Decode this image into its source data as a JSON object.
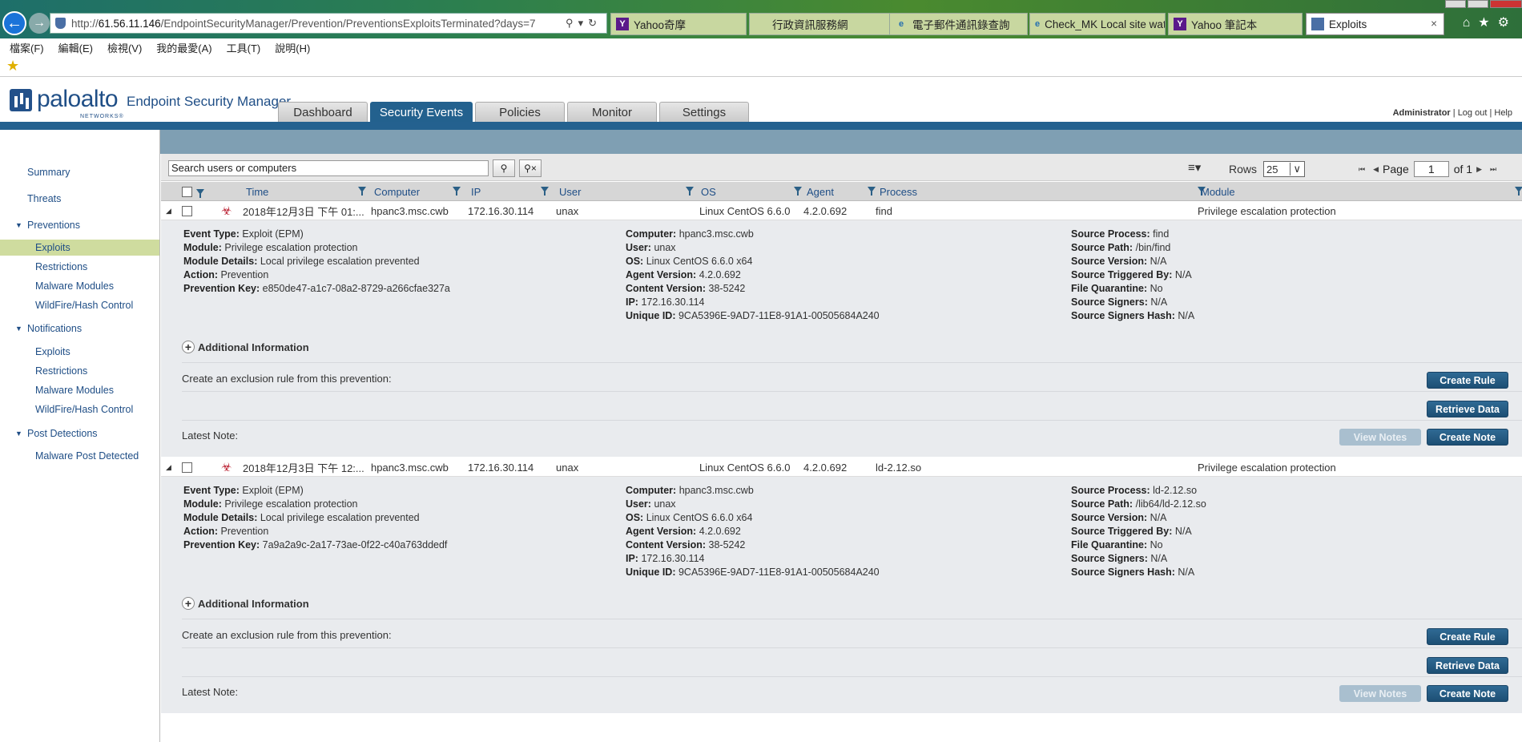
{
  "browser": {
    "url_prefix": "http://",
    "url_host": "61.56.11.146",
    "url_path": "/EndpointSecurityManager/Prevention/PreventionsExploitsTerminated?days=7",
    "tabs": [
      {
        "label": "Yahoo奇摩",
        "icon": "Y"
      },
      {
        "label": "行政資訊服務網",
        "icon": "行"
      },
      {
        "label": "電子郵件通訊錄查詢",
        "icon": "e"
      },
      {
        "label": "Check_MK Local site wat...",
        "icon": "e"
      },
      {
        "label": "Yahoo 筆記本",
        "icon": "Y"
      },
      {
        "label": "Exploits",
        "icon": "shield",
        "active": true
      }
    ],
    "menu": [
      "檔案(F)",
      "編輯(E)",
      "檢視(V)",
      "我的最愛(A)",
      "工具(T)",
      "說明(H)"
    ]
  },
  "app": {
    "logo_word": "paloalto",
    "logo_sub": "NETWORKS®",
    "product": "Endpoint Security Manager",
    "nav": [
      "Dashboard",
      "Security Events",
      "Policies",
      "Monitor",
      "Settings"
    ],
    "active_nav": "Security Events",
    "user": "Administrator",
    "logout": "Log out",
    "help": "Help"
  },
  "sidebar": {
    "summary": "Summary",
    "threats": "Threats",
    "preventions": "Preventions",
    "prev_items": [
      "Exploits",
      "Restrictions",
      "Malware Modules",
      "WildFire/Hash Control"
    ],
    "notifications": "Notifications",
    "notif_items": [
      "Exploits",
      "Restrictions",
      "Malware Modules",
      "WildFire/Hash Control"
    ],
    "post": "Post Detections",
    "post_items": [
      "Malware Post Detected"
    ]
  },
  "toolbar": {
    "search_placeholder": "Search users or computers",
    "rows_label": "Rows",
    "rows_value": "25",
    "page_label": "Page",
    "page_value": "1",
    "of_label": "of 1"
  },
  "columns": [
    "Time",
    "Computer",
    "IP",
    "User",
    "OS",
    "Agent",
    "Process",
    "Module"
  ],
  "events": [
    {
      "time": "2018年12月3日 下午 01:...",
      "computer": "hpanc3.msc.cwb",
      "ip": "172.16.30.114",
      "user": "unax",
      "os": "Linux CentOS 6.6.0",
      "agent": "4.2.0.692",
      "process": "find",
      "module": "Privilege escalation protection",
      "left": [
        [
          "Event Type:",
          "Exploit (EPM)"
        ],
        [
          "Module:",
          "Privilege escalation protection"
        ],
        [
          "Module Details:",
          "Local privilege escalation prevented"
        ],
        [
          "Action:",
          "Prevention"
        ],
        [
          "Prevention Key:",
          "e850de47-a1c7-08a2-8729-a266cfae327a"
        ]
      ],
      "mid": [
        [
          "Computer:",
          "hpanc3.msc.cwb"
        ],
        [
          "User:",
          "unax"
        ],
        [
          "OS:",
          "Linux CentOS 6.6.0 x64"
        ],
        [
          "Agent Version:",
          "4.2.0.692"
        ],
        [
          "Content Version:",
          "38-5242"
        ],
        [
          "IP:",
          "172.16.30.114"
        ],
        [
          "Unique ID:",
          "9CA5396E-9AD7-11E8-91A1-00505684A240"
        ]
      ],
      "right": [
        [
          "Source Process:",
          "find"
        ],
        [
          "Source Path:",
          "/bin/find"
        ],
        [
          "Source Version:",
          "N/A"
        ],
        [
          "Source Triggered By:",
          "N/A"
        ],
        [
          "File Quarantine:",
          "No"
        ],
        [
          "Source Signers:",
          "N/A"
        ],
        [
          "Source Signers Hash:",
          "N/A"
        ]
      ]
    },
    {
      "time": "2018年12月3日 下午 12:...",
      "computer": "hpanc3.msc.cwb",
      "ip": "172.16.30.114",
      "user": "unax",
      "os": "Linux CentOS 6.6.0",
      "agent": "4.2.0.692",
      "process": "ld-2.12.so",
      "module": "Privilege escalation protection",
      "left": [
        [
          "Event Type:",
          "Exploit (EPM)"
        ],
        [
          "Module:",
          "Privilege escalation protection"
        ],
        [
          "Module Details:",
          "Local privilege escalation prevented"
        ],
        [
          "Action:",
          "Prevention"
        ],
        [
          "Prevention Key:",
          "7a9a2a9c-2a17-73ae-0f22-c40a763ddedf"
        ]
      ],
      "mid": [
        [
          "Computer:",
          "hpanc3.msc.cwb"
        ],
        [
          "User:",
          "unax"
        ],
        [
          "OS:",
          "Linux CentOS 6.6.0 x64"
        ],
        [
          "Agent Version:",
          "4.2.0.692"
        ],
        [
          "Content Version:",
          "38-5242"
        ],
        [
          "IP:",
          "172.16.30.114"
        ],
        [
          "Unique ID:",
          "9CA5396E-9AD7-11E8-91A1-00505684A240"
        ]
      ],
      "right": [
        [
          "Source Process:",
          "ld-2.12.so"
        ],
        [
          "Source Path:",
          "/lib64/ld-2.12.so"
        ],
        [
          "Source Version:",
          "N/A"
        ],
        [
          "Source Triggered By:",
          "N/A"
        ],
        [
          "File Quarantine:",
          "No"
        ],
        [
          "Source Signers:",
          "N/A"
        ],
        [
          "Source Signers Hash:",
          "N/A"
        ]
      ]
    }
  ],
  "detail_labels": {
    "additional_info": "Additional Information",
    "exclusion": "Create an exclusion rule from this prevention:",
    "latest_note": "Latest Note:",
    "create_rule": "Create Rule",
    "retrieve_data": "Retrieve Data",
    "view_notes": "View Notes",
    "create_note": "Create Note"
  },
  "colors": {
    "brand": "#1f4e86",
    "header_band": "#24618f",
    "selected": "#cfdc9f"
  }
}
